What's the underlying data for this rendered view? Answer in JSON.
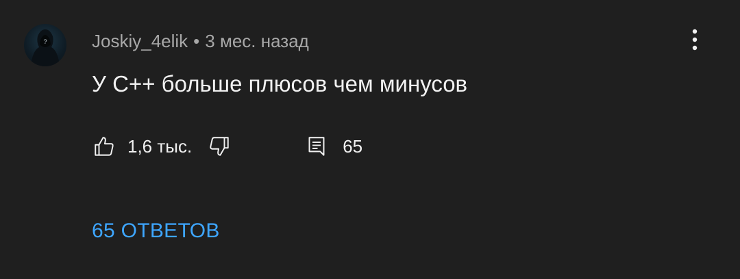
{
  "comment": {
    "author": "Joskiy_4elik",
    "separator": "•",
    "time": "3 мес. назад",
    "text": "У C++ больше плюсов чем минусов",
    "likes": "1,6 тыс.",
    "replies_count": "65",
    "replies_link": "65 ОТВЕТОВ"
  },
  "icons": {
    "avatar": "hooded-figure-avatar",
    "menu": "vertical-dots-icon",
    "like": "thumbs-up-icon",
    "dislike": "thumbs-down-icon",
    "reply": "comment-icon"
  },
  "colors": {
    "background": "#1f1f1f",
    "text_primary": "#f1f1f1",
    "text_secondary": "#a8a8a8",
    "accent_link": "#3ea6ff"
  }
}
